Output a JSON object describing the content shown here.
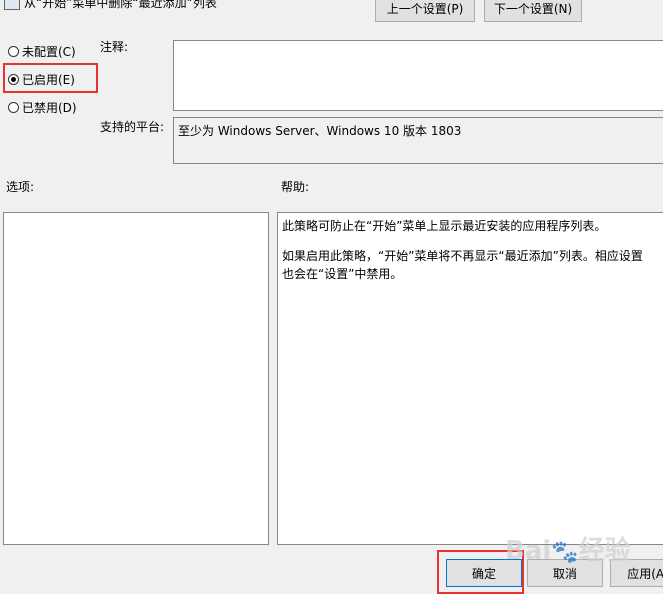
{
  "window": {
    "title": "从“开始”菜单中删除“最近添加”列表"
  },
  "nav": {
    "prev_label": "上一个设置(P)",
    "next_label": "下一个设置(N)"
  },
  "state": {
    "options": [
      {
        "label": "未配置(C)",
        "checked": false
      },
      {
        "label": "已启用(E)",
        "checked": true
      },
      {
        "label": "已禁用(D)",
        "checked": false
      }
    ]
  },
  "comment": {
    "label": "注释:",
    "value": ""
  },
  "platform": {
    "label": "支持的平台:",
    "value": "至少为 Windows Server、Windows 10 版本 1803"
  },
  "options_section": {
    "label": "选项:"
  },
  "help_section": {
    "label": "帮助:",
    "paragraphs": [
      "此策略可防止在“开始”菜单上显示最近安装的应用程序列表。",
      "如果启用此策略，“开始”菜单将不再显示“最近添加”列表。相应设置",
      "也会在“设置”中禁用。"
    ]
  },
  "buttons": {
    "ok": "确定",
    "cancel": "取消",
    "apply": "应用(A)"
  },
  "watermark": "Baidu 经验",
  "colors": {
    "highlight_box": "#e53333"
  }
}
